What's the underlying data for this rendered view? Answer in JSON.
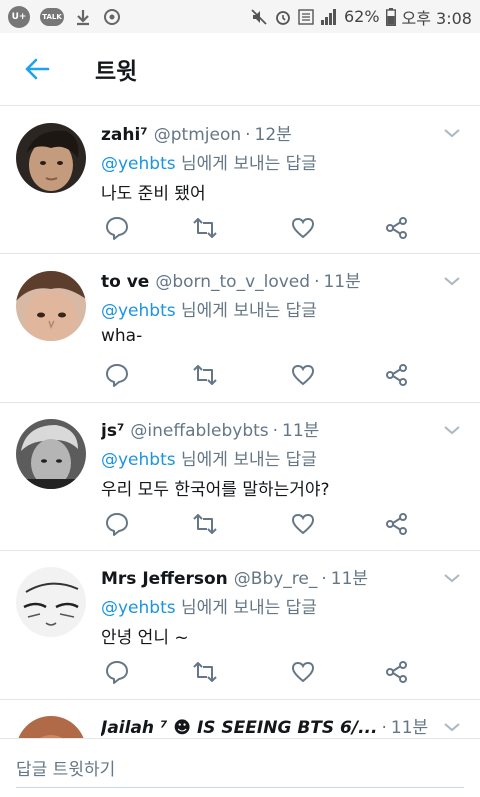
{
  "statusbar": {
    "left_badge": "U+",
    "talk_badge": "TALK",
    "battery": "62%",
    "time": "오후 3:08",
    "icons": [
      "mute-icon",
      "alarm-icon",
      "volte-icon",
      "signal-icon",
      "battery-icon"
    ]
  },
  "header": {
    "title": "트윗"
  },
  "tweets": [
    {
      "name": "zahi⁷",
      "handle": "@ptmjeon",
      "dot": "·",
      "time": "12분",
      "mention": "@yehbts",
      "reply_suffix": "님에게 보내는 답글",
      "text": "나도 준비 됐어"
    },
    {
      "name": "to ve",
      "handle": "@born_to_v_loved",
      "dot": "·",
      "time": "11분",
      "mention": "@yehbts",
      "reply_suffix": "님에게 보내는 답글",
      "text": "wha-"
    },
    {
      "name": "js⁷",
      "handle": "@ineffablebybts",
      "dot": "·",
      "time": "11분",
      "mention": "@yehbts",
      "reply_suffix": "님에게 보내는 답글",
      "text": "우리 모두 한국어를 말하는거야?"
    },
    {
      "name": "Mrs Jefferson",
      "handle": "@Bby_re_",
      "dot": "·",
      "time": "11분",
      "mention": "@yehbts",
      "reply_suffix": "님에게 보내는 답글",
      "text": "안녕 언니 ~"
    },
    {
      "name": "Jailah ⁷ ☻ IS SEEING BTS 6/...",
      "dot": "·",
      "time": "11분"
    }
  ],
  "reply": {
    "placeholder": "답글 트윗하기"
  },
  "colors": {
    "accent": "#1da1f2",
    "mention": "#1b95e0",
    "secondary": "#657786",
    "divider": "#e1e8ed"
  }
}
